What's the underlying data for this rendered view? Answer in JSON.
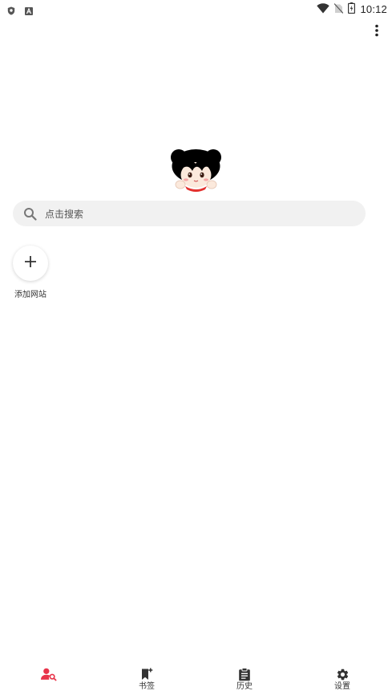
{
  "status_bar": {
    "time": "10:12",
    "left_icons": [
      "shield-icon",
      "text-a-icon"
    ],
    "right_icons": [
      "wifi-icon",
      "no-sim-icon",
      "battery-charging-icon"
    ]
  },
  "top_actions": {
    "overflow_icon": "more-vert-icon"
  },
  "logo": {
    "icon": "mascot-logo"
  },
  "search": {
    "placeholder": "点击搜索",
    "icon": "search-icon"
  },
  "shortcuts": {
    "add_site_label": "添加网站",
    "add_icon": "plus-icon"
  },
  "bottom_nav": {
    "items": [
      {
        "label": "",
        "icon": "user-search-icon",
        "active": true
      },
      {
        "label": "书签",
        "icon": "bookmark-add-icon",
        "active": false
      },
      {
        "label": "历史",
        "icon": "clipboard-list-icon",
        "active": false
      },
      {
        "label": "设置",
        "icon": "gear-icon",
        "active": false
      }
    ]
  },
  "colors": {
    "accent": "#e8344a",
    "icon_dark": "#333333",
    "search_bg": "#f1f1f1",
    "background": "#ffffff"
  }
}
